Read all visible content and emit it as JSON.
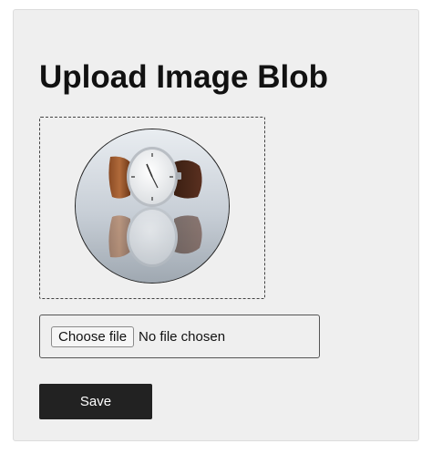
{
  "form": {
    "title": "Upload Image Blob",
    "preview": {
      "alt": "Preview of uploaded image: wristwatch with brown leather strap on reflective surface"
    },
    "file_input": {
      "button_label": "Choose file",
      "status_text": "No file chosen"
    },
    "save_label": "Save"
  },
  "colors": {
    "card_background": "#efefef",
    "save_button": "#222222",
    "save_button_text": "#ffffff"
  }
}
